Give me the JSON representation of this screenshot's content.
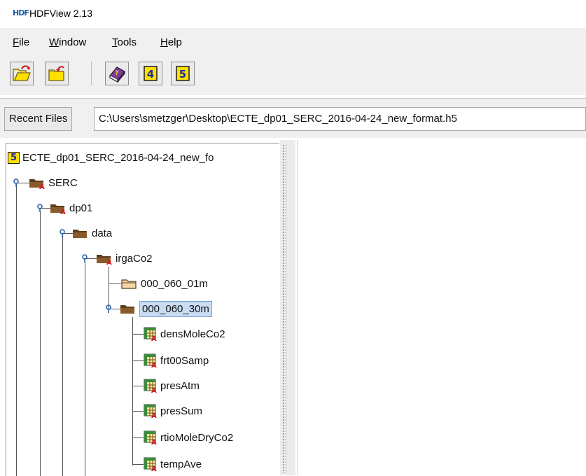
{
  "window": {
    "logo_text": "HDF",
    "title": "HDFView 2.13"
  },
  "menu": [
    {
      "label": "File",
      "mnemonic": "F",
      "rest": "ile"
    },
    {
      "label": "Window",
      "mnemonic": "W",
      "rest": "indow"
    },
    {
      "label": "Tools",
      "mnemonic": "T",
      "rest": "ools"
    },
    {
      "label": "Help",
      "mnemonic": "H",
      "rest": "elp"
    }
  ],
  "toolbar": {
    "buttons": [
      {
        "name": "open-file-icon"
      },
      {
        "name": "close-file-icon"
      },
      {
        "name": "user-guide-icon"
      },
      {
        "name": "hdf4-library-icon",
        "text": "4"
      },
      {
        "name": "hdf5-library-icon",
        "text": "5"
      }
    ]
  },
  "recent": {
    "button_label": "Recent Files",
    "path": "C:\\Users\\smetzger\\Desktop\\ECTE_dp01_SERC_2016-04-24_new_format.h5"
  },
  "tree": {
    "root": {
      "badge": "5",
      "label": "ECTE_dp01_SERC_2016-04-24_new_fo"
    },
    "nodes": [
      {
        "label": "SERC",
        "type": "group-attr"
      },
      {
        "label": "dp01",
        "type": "group-attr"
      },
      {
        "label": "data",
        "type": "group"
      },
      {
        "label": "irgaCo2",
        "type": "group-attr"
      },
      {
        "label": "000_060_01m",
        "type": "group-closed"
      },
      {
        "label": "000_060_30m",
        "type": "group",
        "selected": true
      },
      {
        "label": "densMoleCo2",
        "type": "dataset"
      },
      {
        "label": "frt00Samp",
        "type": "dataset"
      },
      {
        "label": "presAtm",
        "type": "dataset"
      },
      {
        "label": "presSum",
        "type": "dataset"
      },
      {
        "label": "rtioMoleDryCo2",
        "type": "dataset"
      },
      {
        "label": "tempAve",
        "type": "dataset"
      }
    ]
  },
  "colors": {
    "folder": "#5a3c1e",
    "folder_open_light": "#f5d6a8",
    "attr_marker": "#d11a1a",
    "badge_yellow": "#ffe000",
    "selection": "#c9dcf2"
  }
}
